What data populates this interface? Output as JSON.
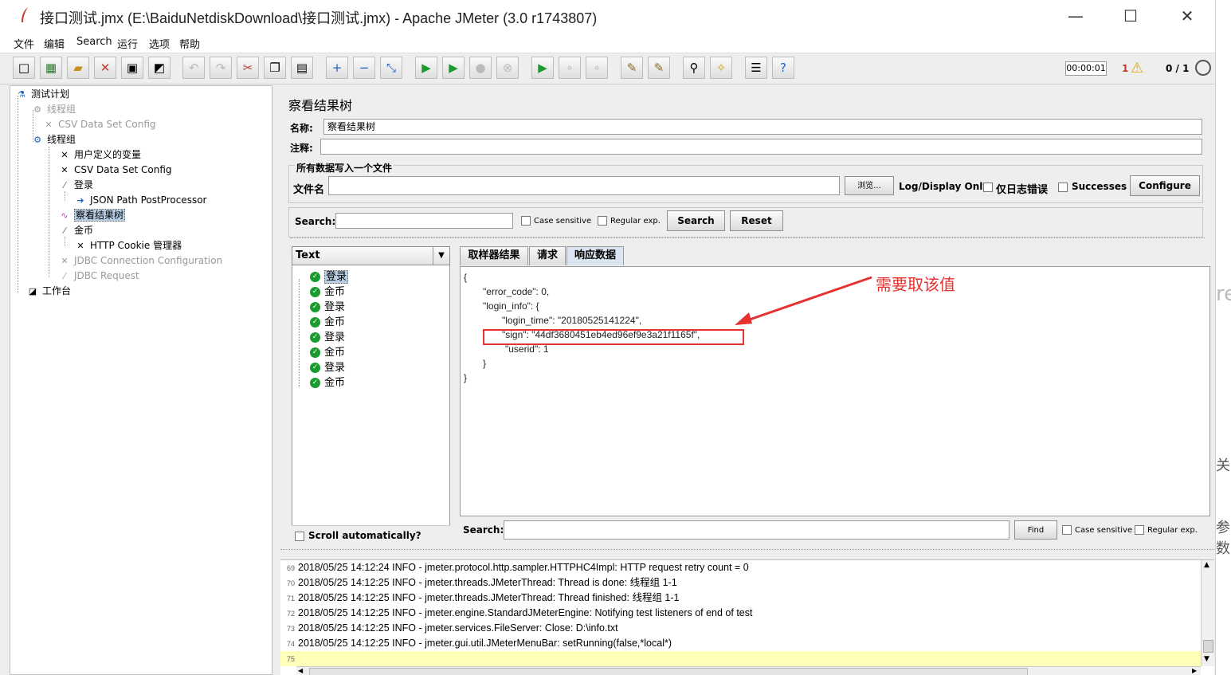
{
  "window": {
    "title": "接口测试.jmx (E:\\BaiduNetdiskDownload\\接口测试.jmx) - Apache JMeter (3.0 r1743807)",
    "min_glyph": "—",
    "max_glyph": "☐",
    "close_glyph": "✕"
  },
  "menu": [
    "文件",
    "编辑",
    "Search",
    "运行",
    "选项",
    "帮助"
  ],
  "status": {
    "timer": "00:00:01",
    "warnings": "1",
    "threads": "0 / 1"
  },
  "tree": {
    "items": [
      {
        "label": "测试计划",
        "icon": "flask-icon"
      },
      {
        "label": "线程组",
        "icon": "gear-icon"
      },
      {
        "label": "CSV Data Set Config",
        "icon": "tools-icon"
      },
      {
        "label": "线程组",
        "icon": "gear-icon"
      },
      {
        "label": "用户定义的变量",
        "icon": "tools-icon"
      },
      {
        "label": "CSV Data Set Config",
        "icon": "tools-icon"
      },
      {
        "label": "登录",
        "icon": "pipette-icon"
      },
      {
        "label": "JSON Path PostProcessor",
        "icon": "arrow-icon"
      },
      {
        "label": "察看结果树",
        "icon": "graph-icon"
      },
      {
        "label": "金币",
        "icon": "pipette-icon"
      },
      {
        "label": "HTTP Cookie 管理器",
        "icon": "tools-icon"
      },
      {
        "label": "JDBC Connection Configuration",
        "icon": "tools-icon"
      },
      {
        "label": "JDBC Request",
        "icon": "pipette-icon"
      },
      {
        "label": "工作台",
        "icon": "workbench-icon"
      }
    ]
  },
  "form": {
    "page_title": "察看结果树",
    "name_label": "名称:",
    "name_value": "察看结果树",
    "comment_label": "注释:",
    "comment_value": "",
    "file_group_title": "所有数据写入一个文件",
    "filename_label": "文件名",
    "filename_value": "",
    "browse_label": "浏览...",
    "log_display_label": "Log/Display Only:",
    "errors_only_label": "仅日志错误",
    "successes_label": "Successes",
    "configure_label": "Configure"
  },
  "search": {
    "label": "Search:",
    "value": "",
    "case_sensitive": "Case sensitive",
    "regular_exp": "Regular exp.",
    "search_button": "Search",
    "reset_button": "Reset"
  },
  "results": {
    "renderer": "Text",
    "items": [
      "登录",
      "金币",
      "登录",
      "金币",
      "登录",
      "金币",
      "登录",
      "金币"
    ],
    "scroll_auto": "Scroll automatically?"
  },
  "tabs": [
    "取样器结果",
    "请求",
    "响应数据"
  ],
  "response": {
    "lines": [
      "{",
      "\"error_code\": 0,",
      "\"login_info\": {",
      "\"login_time\": \"20180525141224\",",
      "\"sign\": \"44df3680451eb4ed96ef9e3a21f1165f\",",
      "\"userid\": 1",
      "}",
      "}"
    ],
    "find_label": "Search:",
    "find_value": "",
    "find_button": "Find",
    "case_sensitive": "Case sensitive",
    "regular_exp": "Regular exp."
  },
  "annotation": {
    "text": "需要取该值",
    "color": "#e5312f"
  },
  "log": [
    {
      "n": "69",
      "text": "2018/05/25 14:12:24 INFO  - jmeter.protocol.http.sampler.HTTPHC4Impl: HTTP request retry count = 0"
    },
    {
      "n": "70",
      "text": "2018/05/25 14:12:25 INFO  - jmeter.threads.JMeterThread: Thread is done: 线程组 1-1"
    },
    {
      "n": "71",
      "text": "2018/05/25 14:12:25 INFO  - jmeter.threads.JMeterThread: Thread finished: 线程组 1-1"
    },
    {
      "n": "72",
      "text": "2018/05/25 14:12:25 INFO  - jmeter.engine.StandardJMeterEngine: Notifying test listeners of end of test"
    },
    {
      "n": "73",
      "text": "2018/05/25 14:12:25 INFO  - jmeter.services.FileServer: Close: D:\\info.txt"
    },
    {
      "n": "74",
      "text": "2018/05/25 14:12:25 INFO  - jmeter.gui.util.JMeterMenuBar: setRunning(false,*local*)"
    },
    {
      "n": "75",
      "text": ""
    }
  ],
  "background_fragments": [
    "re",
    "关",
    "参数"
  ]
}
